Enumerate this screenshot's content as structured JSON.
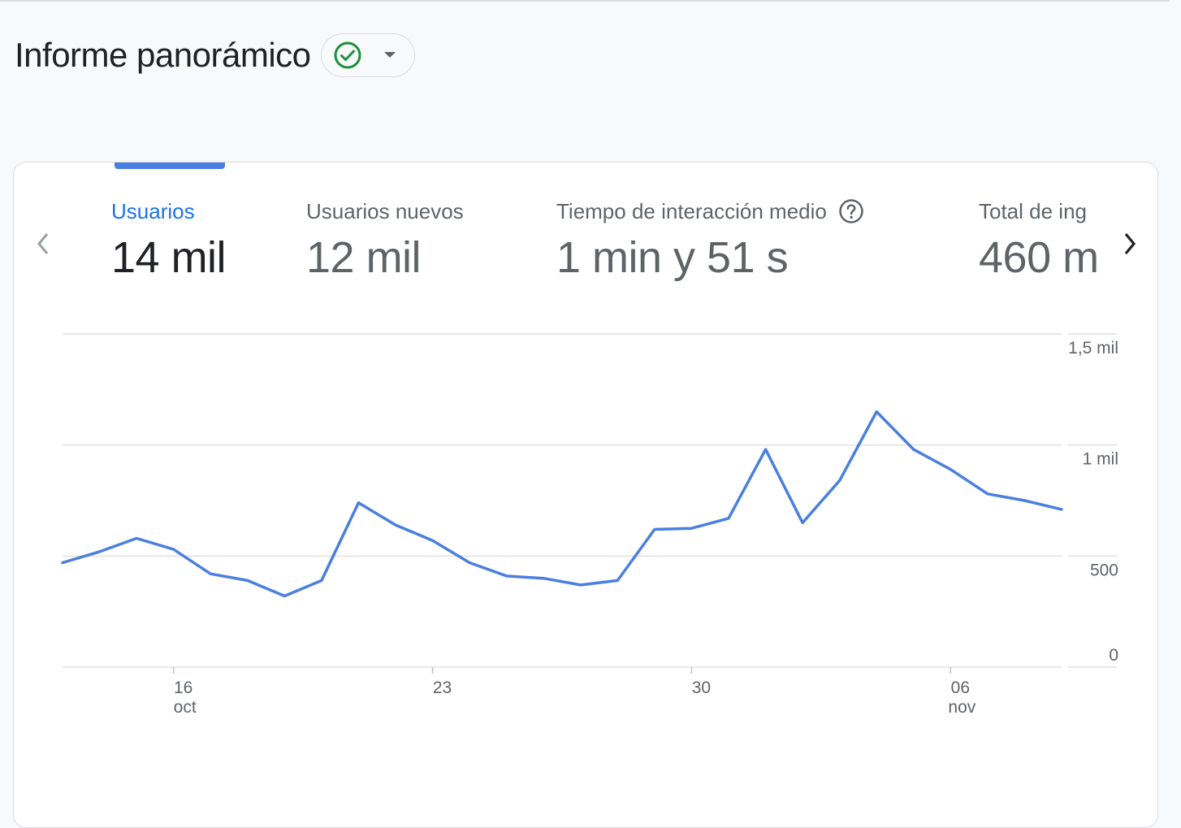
{
  "header": {
    "title": "Informe panorámico",
    "status_icon": "check-circle-icon",
    "dropdown_icon": "caret-down-icon",
    "status_color": "#1e8e3e"
  },
  "metrics": [
    {
      "label": "Usuarios",
      "value": "14 mil",
      "active": true
    },
    {
      "label": "Usuarios nuevos",
      "value": "12 mil",
      "active": false
    },
    {
      "label": "Tiempo de interacción medio",
      "value": "1 min y 51 s",
      "active": false,
      "help_icon": "help-circle-icon"
    },
    {
      "label": "Total de ing",
      "value": "460 m",
      "active": false
    }
  ],
  "nav": {
    "prev_icon": "chevron-left-icon",
    "next_icon": "chevron-right-icon"
  },
  "colors": {
    "accent": "#1a73e8",
    "line": "#4a7fe0",
    "grid": "#e0e0e0"
  },
  "chart_data": {
    "type": "line",
    "series": [
      {
        "values": [
          470,
          520,
          580,
          530,
          420,
          390,
          320,
          390,
          740,
          640,
          570,
          470,
          410,
          400,
          370,
          390,
          620,
          625,
          670,
          980,
          650,
          840,
          1150,
          980,
          890,
          780,
          750,
          710
        ]
      }
    ],
    "x": [
      "13 oct",
      "14 oct",
      "15 oct",
      "16 oct",
      "17 oct",
      "18 oct",
      "19 oct",
      "20 oct",
      "21 oct",
      "22 oct",
      "23 oct",
      "24 oct",
      "25 oct",
      "26 oct",
      "27 oct",
      "28 oct",
      "29 oct",
      "30 oct",
      "31 oct",
      "01 nov",
      "02 nov",
      "03 nov",
      "04 nov",
      "05 nov",
      "06 nov",
      "07 nov",
      "08 nov",
      "09 nov"
    ],
    "x_ticks": [
      {
        "index": 3,
        "day": "16",
        "month": "oct"
      },
      {
        "index": 10,
        "day": "23",
        "month": ""
      },
      {
        "index": 17,
        "day": "30",
        "month": ""
      },
      {
        "index": 24,
        "day": "06",
        "month": "nov"
      }
    ],
    "y_ticks": [
      {
        "value": 0,
        "label": "0"
      },
      {
        "value": 500,
        "label": "500"
      },
      {
        "value": 1000,
        "label": "1 mil"
      },
      {
        "value": 1500,
        "label": "1,5 mil"
      }
    ],
    "ylim": [
      0,
      1500
    ],
    "grid": true
  }
}
